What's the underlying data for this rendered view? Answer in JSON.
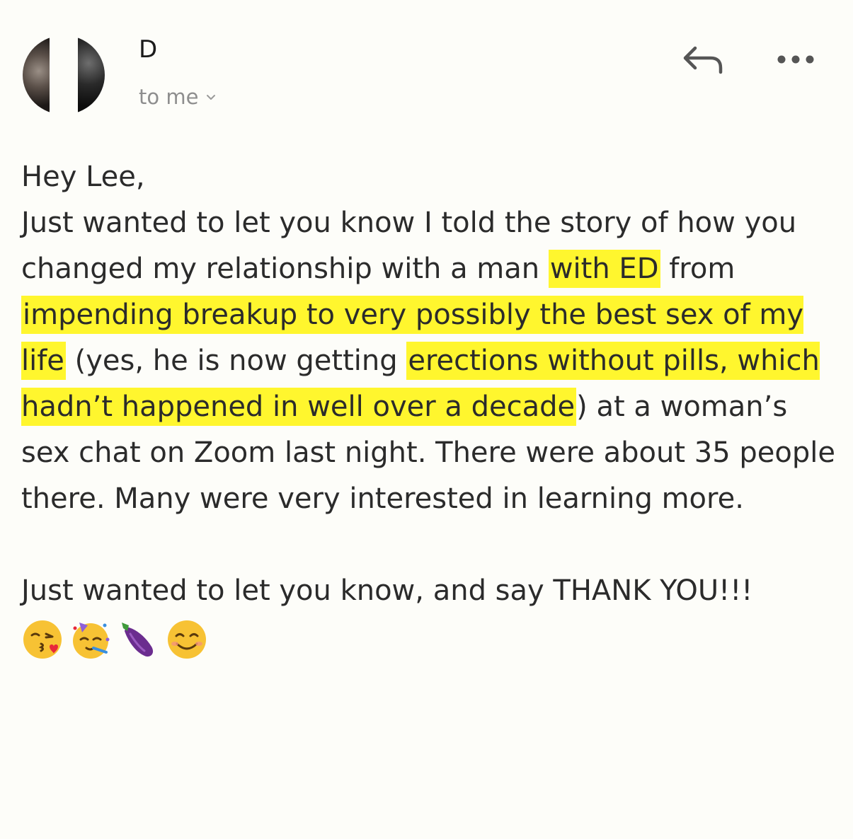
{
  "email": {
    "sender": "D",
    "recipient": "to me",
    "actions": {
      "reply_icon": "reply-icon",
      "more_icon": "more-horizontal-icon"
    },
    "body": {
      "greeting": "Hey Lee,",
      "p1": {
        "s1": "Just wanted to let you know I told the story of how you changed my relationship with a man ",
        "h1": "with ED",
        "s2": " from ",
        "h2": "impending breakup to very possibly the best sex of my life",
        "s3": " (yes, he is now getting ",
        "h3": "erections without pills, which hadn’t happened in well over a decade",
        "s4": ") at a woman’s sex chat on Zoom last night. There were about 35 people there. Many were very interested in learning more."
      },
      "p2": "Just wanted to let you know, and say THANK YOU!!!",
      "emojis": [
        "kissing-heart-emoji",
        "partying-face-emoji",
        "eggplant-emoji",
        "smiling-face-emoji"
      ]
    },
    "highlight_color": "#fff62e"
  }
}
